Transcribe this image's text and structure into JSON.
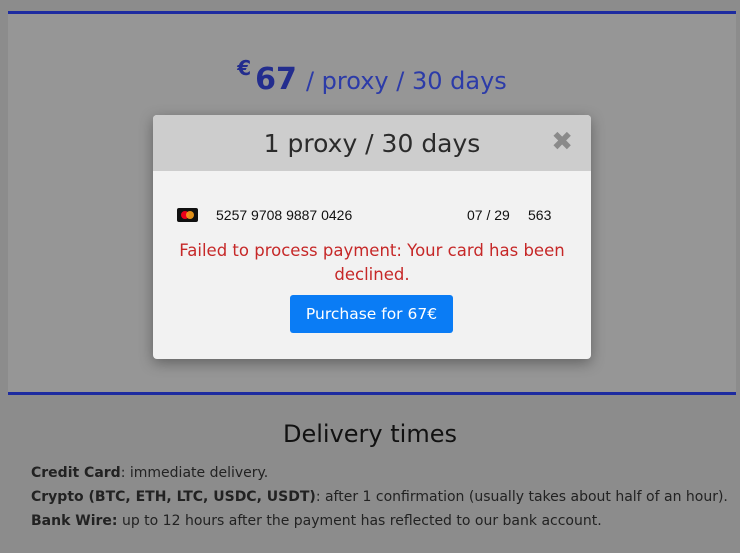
{
  "pricing": {
    "currency_symbol": "€",
    "amount": "67",
    "period": "/ proxy / 30 days"
  },
  "delivery": {
    "title": "Delivery times",
    "items": [
      {
        "label": "Credit Card",
        "text": ": immediate delivery."
      },
      {
        "label": "Crypto (BTC, ETH, LTC, USDC, USDT)",
        "text": ": after 1 confirmation (usually takes about half of an hour)."
      },
      {
        "label": "Bank Wire:",
        "text": " up to 12 hours after the payment has reflected to our bank account."
      }
    ]
  },
  "modal": {
    "title": "1 proxy / 30 days",
    "close_icon": "✖",
    "card": {
      "brand_icon": "mastercard-icon",
      "number": "5257 9708 9887 0426",
      "expiry": "07 / 29",
      "cvc": "563"
    },
    "error_message": "Failed to process payment: Your card has been declined.",
    "purchase_label": "Purchase for 67€"
  },
  "colors": {
    "accent": "#1d2ba0",
    "button": "#0a7cf5",
    "error": "#c62828"
  }
}
